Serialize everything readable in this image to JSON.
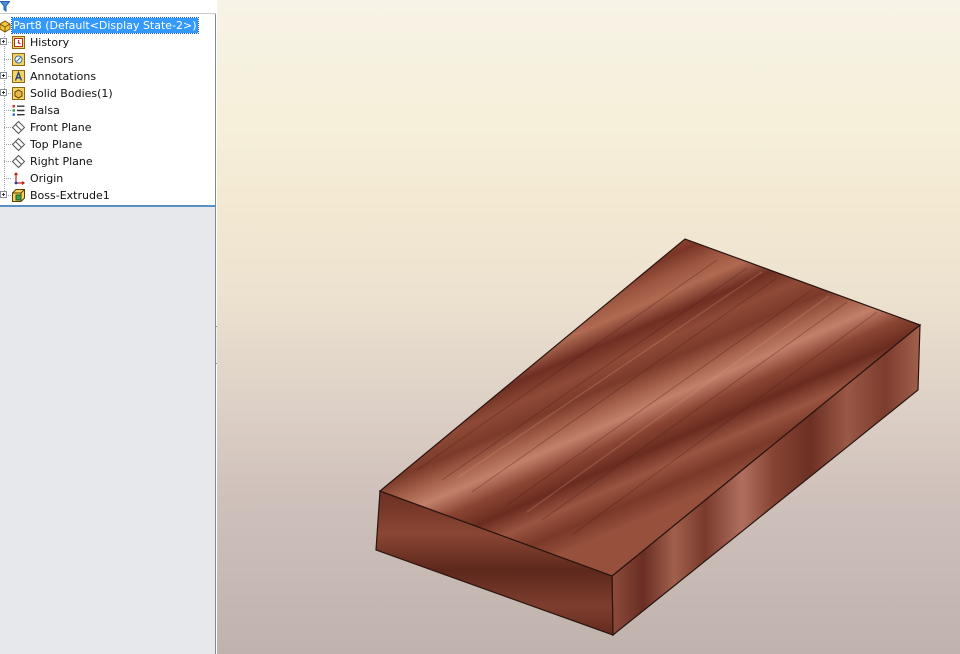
{
  "tree": {
    "root": {
      "label": "Part8  (Default<Display State-2>)"
    },
    "items": [
      {
        "label": "History",
        "icon": "history-icon",
        "expandable": true
      },
      {
        "label": "Sensors",
        "icon": "sensors-icon",
        "expandable": false
      },
      {
        "label": "Annotations",
        "icon": "annotations-icon",
        "expandable": true
      },
      {
        "label": "Solid Bodies(1)",
        "icon": "solid-bodies-icon",
        "expandable": true
      },
      {
        "label": "Balsa",
        "icon": "material-icon",
        "expandable": false
      },
      {
        "label": "Front Plane",
        "icon": "plane-icon",
        "expandable": false
      },
      {
        "label": "Top Plane",
        "icon": "plane-icon",
        "expandable": false
      },
      {
        "label": "Right Plane",
        "icon": "plane-icon",
        "expandable": false
      },
      {
        "label": "Origin",
        "icon": "origin-icon",
        "expandable": false
      },
      {
        "label": "Boss-Extrude1",
        "icon": "boss-extrude-icon",
        "expandable": true
      }
    ]
  },
  "colors": {
    "selection": "#3399ff",
    "wood_dark": "#6b2f20",
    "wood_light": "#a8604a"
  }
}
